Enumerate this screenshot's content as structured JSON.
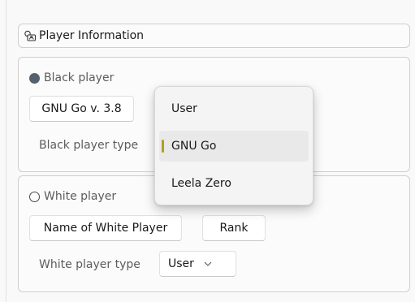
{
  "header": {
    "title": "Player Information",
    "icon": "player-info-icon"
  },
  "black": {
    "title": "Black player",
    "name_value": "GNU Go v. 3.8",
    "type_label": "Black player type"
  },
  "white": {
    "title": "White player",
    "name_value": "Name of White Player",
    "rank_label": "Rank",
    "type_label": "White player type",
    "type_value": "User"
  },
  "dropdown": {
    "options": [
      "User",
      "GNU Go",
      "Leela Zero"
    ],
    "selected_index": 1,
    "accent": "#b3a020"
  }
}
